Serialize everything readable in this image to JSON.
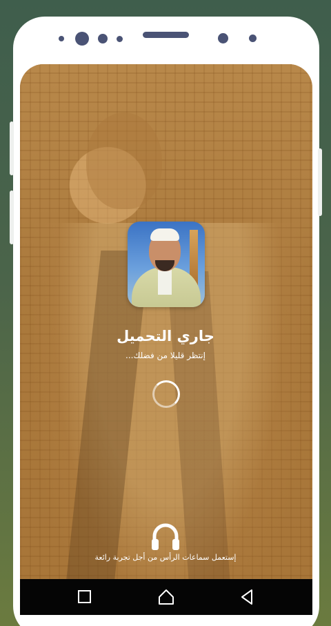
{
  "loading": {
    "title": "جاري التحميل",
    "subtitle": "إنتظر قليلا من فضلك..."
  },
  "footer": {
    "hint": "إستعمل سماعات الرأس من أجل تجربة رائعة"
  },
  "icons": {
    "app": "app-icon-portrait",
    "spinner": "loading-spinner-icon",
    "headphones": "headphones-icon",
    "nav_recents": "square-icon",
    "nav_home": "home-icon",
    "nav_back": "back-triangle-icon"
  },
  "colors": {
    "overlay": "#b07c3c",
    "text": "#ffffff",
    "navbar": "#050505",
    "frame": "#ffffff"
  }
}
